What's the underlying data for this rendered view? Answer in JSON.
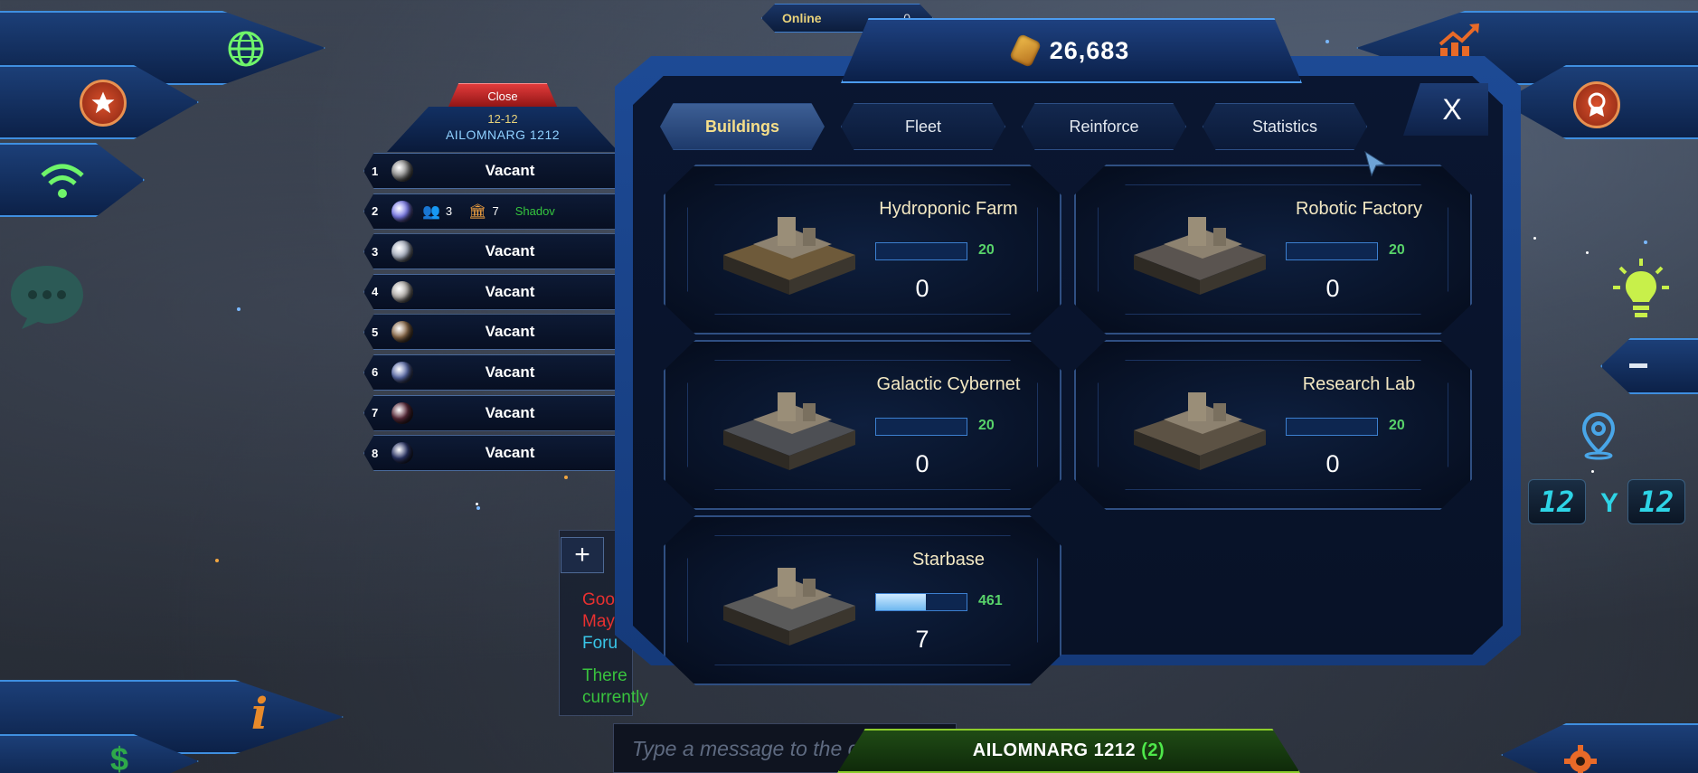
{
  "hud": {
    "online_label": "Online",
    "online_count": "0",
    "currency_amount": "26,683"
  },
  "planet_panel": {
    "close_label": "Close",
    "coordinates": "12-12",
    "system_name": "AILOMNARG 1212",
    "planets": [
      {
        "num": "1",
        "status": "Vacant",
        "color": "#8a8a8a"
      },
      {
        "num": "2",
        "status": "",
        "color": "#7a7ae8",
        "population": "3",
        "buildings": "7",
        "owner": "Shadov"
      },
      {
        "num": "3",
        "status": "Vacant",
        "color": "#a8b0c0"
      },
      {
        "num": "4",
        "status": "Vacant",
        "color": "#b0aca8"
      },
      {
        "num": "5",
        "status": "Vacant",
        "color": "#8a6a4a"
      },
      {
        "num": "6",
        "status": "Vacant",
        "color": "#5a6aa8"
      },
      {
        "num": "7",
        "status": "Vacant",
        "color": "#5a2a3a"
      },
      {
        "num": "8",
        "status": "Vacant",
        "color": "#2a3466"
      }
    ]
  },
  "tabs": [
    {
      "label": "Buildings",
      "active": true
    },
    {
      "label": "Fleet",
      "active": false
    },
    {
      "label": "Reinforce",
      "active": false
    },
    {
      "label": "Statistics",
      "active": false
    }
  ],
  "close_button_label": "X",
  "buildings": [
    {
      "name": "Hydroponic Farm",
      "capacity": "20",
      "level": "0",
      "progress": 0
    },
    {
      "name": "Robotic Factory",
      "capacity": "20",
      "level": "0",
      "progress": 0
    },
    {
      "name": "Galactic Cybernet",
      "capacity": "20",
      "level": "0",
      "progress": 0
    },
    {
      "name": "Research Lab",
      "capacity": "20",
      "level": "0",
      "progress": 0
    },
    {
      "name": "Starbase",
      "capacity": "461",
      "level": "7",
      "progress": 0.55
    }
  ],
  "chat": {
    "lines": [
      "Goo",
      "May",
      "Foru",
      "There",
      "currently"
    ],
    "input_placeholder": "Type a message to the galaxy"
  },
  "footer": {
    "system_name": "AILOMNARG 1212",
    "system_count": "(2)"
  },
  "nav": {
    "x_value": "12",
    "y_label": "Y",
    "y_value": "12"
  },
  "icons": [
    "globe-icon",
    "star-icon",
    "wifi-icon",
    "chat-bubble-icon",
    "info-icon",
    "dollar-icon",
    "trend-up-icon",
    "medal-icon",
    "lightbulb-icon",
    "location-pin-icon",
    "minus-icon",
    "gear-icon",
    "cursor-icon"
  ]
}
